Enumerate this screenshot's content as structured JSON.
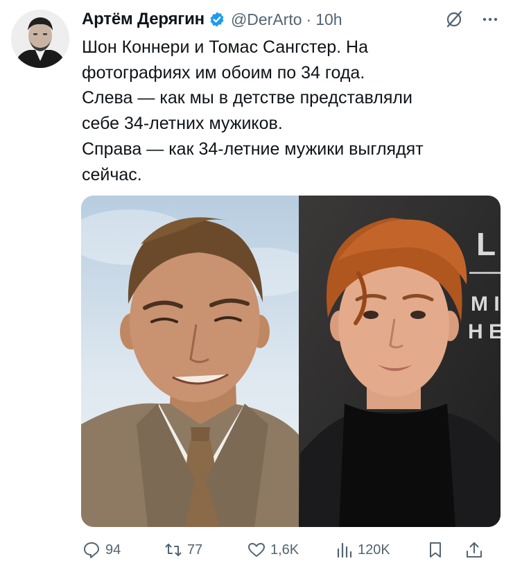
{
  "tweet": {
    "author_name": "Артём Дерягин",
    "handle": "@DerArto",
    "separator": "·",
    "time": "10h",
    "verified": true,
    "text_lines": [
      "Шон Коннери и Томас Сангстер. На",
      "фотографиях им обоим по 34 года.",
      "Слева — как мы в детстве представляли",
      "себе 34-летних мужиков.",
      "Справа — как 34-летние мужики выглядят",
      "сейчас."
    ],
    "media": {
      "left_photo": "sean-connery-photo",
      "right_photo": "thomas-sangster-photo",
      "sign_letters": [
        "L",
        "M I",
        "H E"
      ]
    }
  },
  "actions": {
    "reply_count": "94",
    "retweet_count": "77",
    "like_count": "1,6K",
    "views_count": "120K"
  },
  "icons": {
    "verified": "verified-badge-icon",
    "grok": "grok-icon",
    "more": "more-icon",
    "reply": "reply-icon",
    "retweet": "retweet-icon",
    "like": "heart-icon",
    "views": "views-icon",
    "bookmark": "bookmark-icon",
    "share": "share-icon"
  },
  "colors": {
    "text": "#0f1419",
    "secondary": "#536471",
    "verified": "#1d9bf0",
    "background": "#ffffff"
  }
}
